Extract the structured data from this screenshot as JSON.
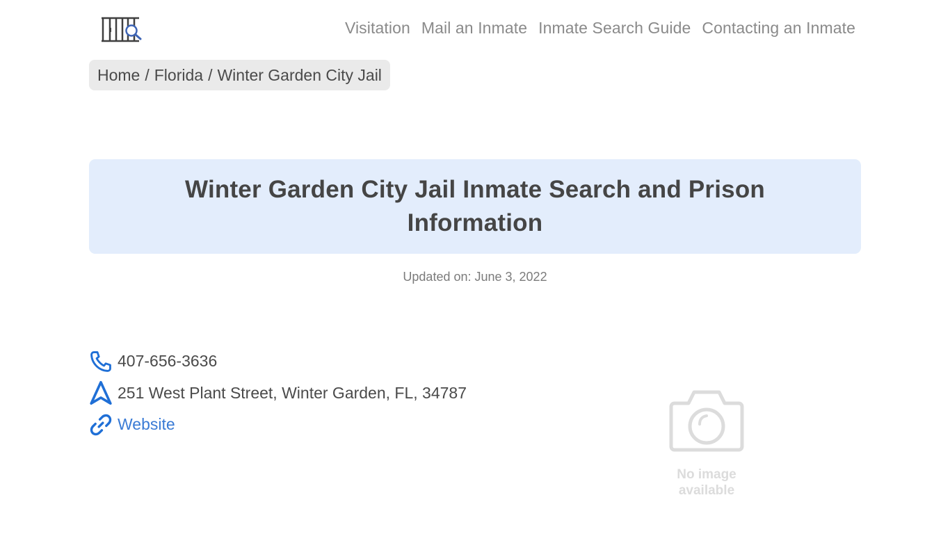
{
  "header": {
    "logo_icon": "jail-bars-search-icon",
    "nav": [
      {
        "label": "Visitation"
      },
      {
        "label": "Mail an Inmate"
      },
      {
        "label": "Inmate Search Guide"
      },
      {
        "label": "Contacting an Inmate"
      }
    ]
  },
  "breadcrumb": {
    "items": [
      "Home",
      "Florida",
      "Winter Garden City Jail"
    ],
    "separator": "/"
  },
  "main": {
    "title": "Winter Garden City Jail Inmate Search and Prison Information",
    "updated": "Updated on: June 3, 2022"
  },
  "contact": {
    "phone": {
      "icon": "phone-icon",
      "text": "407-656-3636"
    },
    "address": {
      "icon": "navigation-arrow-icon",
      "text": "251 West Plant Street, Winter Garden, FL, 34787"
    },
    "website": {
      "icon": "link-icon",
      "text": "Website"
    }
  },
  "image_placeholder": {
    "icon": "camera-icon",
    "line1": "No image",
    "line2": "available"
  },
  "colors": {
    "accent": "#1f6fd6",
    "title_bg": "#e3edfc",
    "breadcrumb_bg": "#eaeaea",
    "link": "#3a7bd5"
  }
}
